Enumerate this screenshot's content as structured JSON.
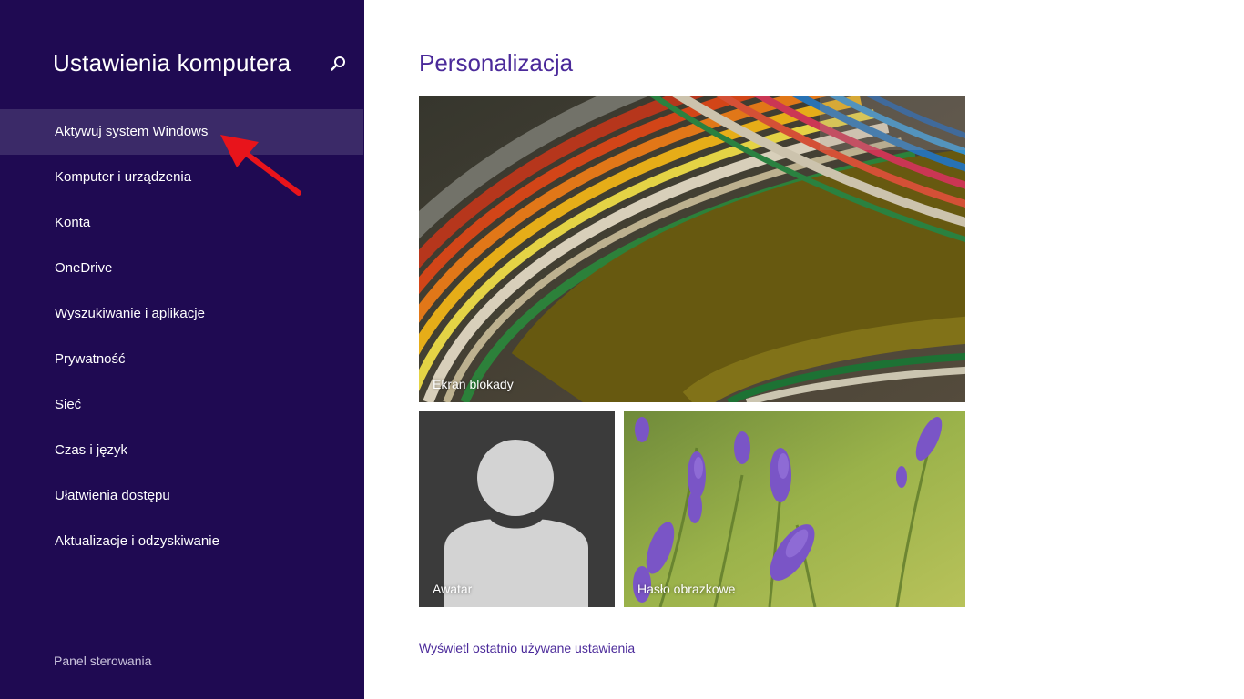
{
  "sidebar": {
    "title": "Ustawienia komputera",
    "search_icon": "search-icon",
    "items": [
      {
        "label": "Aktywuj system Windows",
        "selected": true
      },
      {
        "label": "Komputer i urządzenia"
      },
      {
        "label": "Konta"
      },
      {
        "label": "OneDrive"
      },
      {
        "label": "Wyszukiwanie i aplikacje"
      },
      {
        "label": "Prywatność"
      },
      {
        "label": "Sieć"
      },
      {
        "label": "Czas i język"
      },
      {
        "label": "Ułatwienia dostępu"
      },
      {
        "label": "Aktualizacje i odzyskiwanie"
      }
    ],
    "footer_link": "Panel sterowania"
  },
  "main": {
    "title": "Personalizacja",
    "tiles": {
      "lock_screen": {
        "label": "Ekran blokady"
      },
      "avatar": {
        "label": "Awatar"
      },
      "picture_password": {
        "label": "Hasło obrazkowe"
      }
    },
    "recent_link": "Wyświetl ostatnio używane ustawienia"
  },
  "colors": {
    "sidebar_bg": "#1f0a52",
    "selected_item_bg": "#3b2a68",
    "accent": "#4b2a9a",
    "annotation_arrow": "#e8141b"
  }
}
